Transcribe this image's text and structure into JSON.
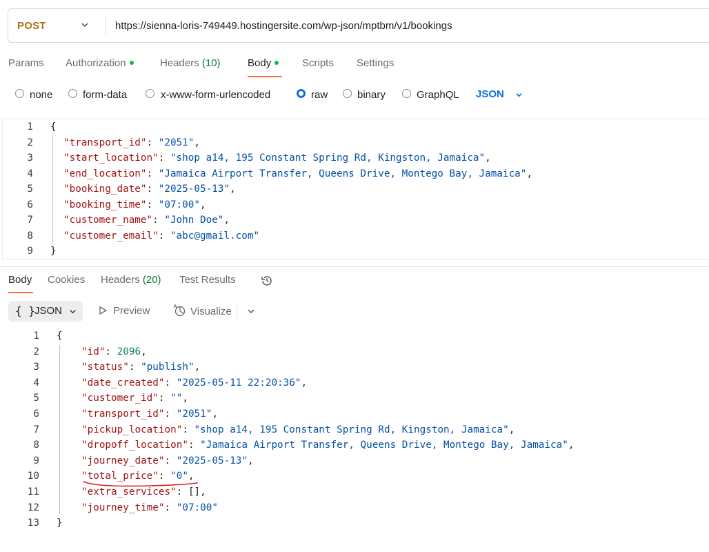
{
  "request": {
    "method": "POST",
    "url": "https://sienna-loris-749449.hostingersite.com/wp-json/mptbm/v1/bookings"
  },
  "request_tabs": [
    {
      "label": "Params"
    },
    {
      "label": "Authorization"
    },
    {
      "label": "Headers",
      "count": "(10)"
    },
    {
      "label": "Body"
    },
    {
      "label": "Scripts"
    },
    {
      "label": "Settings"
    }
  ],
  "body_types": {
    "none": "none",
    "form_data": "form-data",
    "urlencoded": "x-www-form-urlencoded",
    "raw": "raw",
    "binary": "binary",
    "graphql": "GraphQL",
    "format": "JSON"
  },
  "request_body": {
    "open": "{",
    "close": "}",
    "fields": [
      {
        "key": "\"transport_id\"",
        "value": "\"2051\","
      },
      {
        "key": "\"start_location\"",
        "value": "\"shop a14, 195 Constant Spring Rd, Kingston, Jamaica\","
      },
      {
        "key": "\"end_location\"",
        "value": "\"Jamaica Airport Transfer, Queens Drive, Montego Bay, Jamaica\","
      },
      {
        "key": "\"booking_date\"",
        "value": "\"2025-05-13\","
      },
      {
        "key": "\"booking_time\"",
        "value": "\"07:00\","
      },
      {
        "key": "\"customer_name\"",
        "value": "\"John Doe\","
      },
      {
        "key": "\"customer_email\"",
        "value": "\"abc@gmail.com\""
      }
    ],
    "line_numbers": [
      "1",
      "2",
      "3",
      "4",
      "5",
      "6",
      "7",
      "8",
      "9"
    ]
  },
  "response_tabs": {
    "body": "Body",
    "cookies": "Cookies",
    "headers": "Headers",
    "headers_count": "(20)",
    "test_results": "Test Results"
  },
  "response_view": {
    "format_braces": "{ }",
    "format": "JSON",
    "preview": "Preview",
    "visualize": "Visualize"
  },
  "response_body": {
    "open": "{",
    "close": "}",
    "fields": [
      {
        "key": "\"id\"",
        "value": "2096",
        "tail": ",",
        "type": "number"
      },
      {
        "key": "\"status\"",
        "value": "\"publish\"",
        "tail": ",",
        "type": "string"
      },
      {
        "key": "\"date_created\"",
        "value": "\"2025-05-11 22:20:36\"",
        "tail": ",",
        "type": "string"
      },
      {
        "key": "\"customer_id\"",
        "value": "\"\"",
        "tail": ",",
        "type": "string"
      },
      {
        "key": "\"transport_id\"",
        "value": "\"2051\"",
        "tail": ",",
        "type": "string"
      },
      {
        "key": "\"pickup_location\"",
        "value": "\"shop a14, 195 Constant Spring Rd, Kingston, Jamaica\"",
        "tail": ",",
        "type": "string"
      },
      {
        "key": "\"dropoff_location\"",
        "value": "\"Jamaica Airport Transfer, Queens Drive, Montego Bay, Jamaica\"",
        "tail": ",",
        "type": "string"
      },
      {
        "key": "\"journey_date\"",
        "value": "\"2025-05-13\"",
        "tail": ",",
        "type": "string"
      },
      {
        "key": "\"total_price\"",
        "value": "\"0\"",
        "tail": ",",
        "type": "string"
      },
      {
        "key": "\"extra_services\"",
        "value": "[]",
        "tail": ",",
        "type": "plain"
      },
      {
        "key": "\"journey_time\"",
        "value": "\"07:00\"",
        "tail": "",
        "type": "string"
      }
    ],
    "line_numbers": [
      "1",
      "2",
      "3",
      "4",
      "5",
      "6",
      "7",
      "8",
      "9",
      "10",
      "11",
      "12",
      "13"
    ]
  },
  "colors": {
    "method": "#a8740e",
    "accent": "#ff6c37",
    "active_dot": "#0cbb52",
    "json_key": "#a31515",
    "json_string": "#0451a5",
    "json_number": "#098658",
    "annotation_mark": "#e01b1b"
  }
}
